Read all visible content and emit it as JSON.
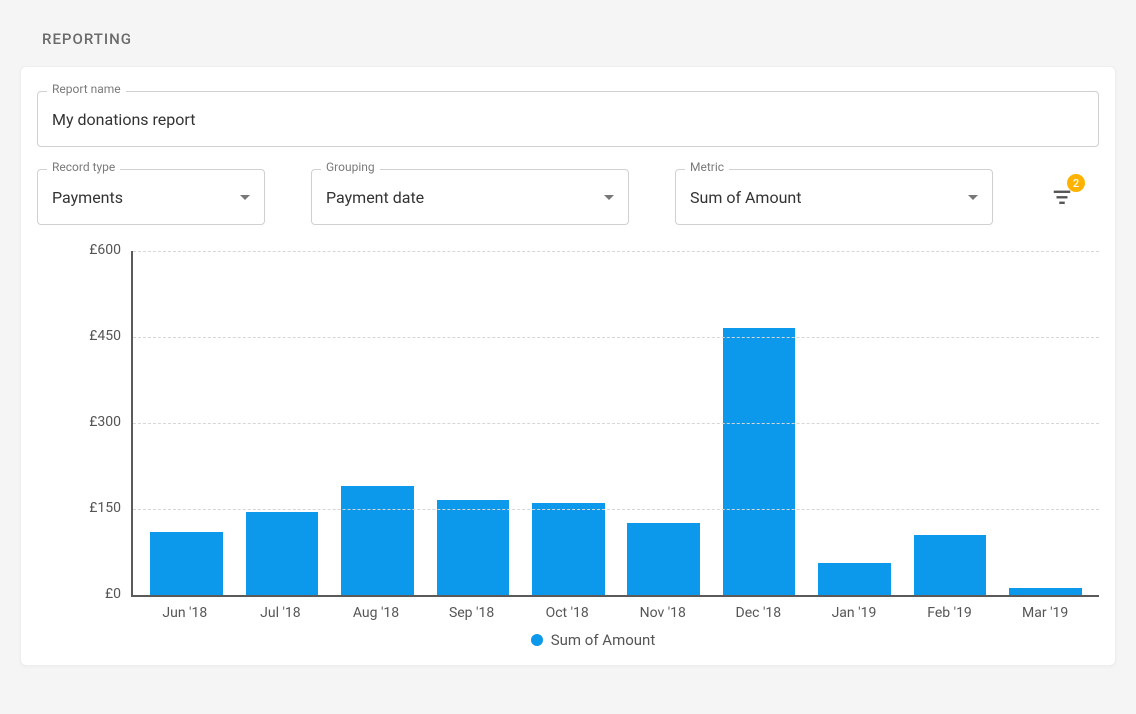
{
  "page_title": "REPORTING",
  "report_name": {
    "label": "Report name",
    "value": "My donations report"
  },
  "selects": {
    "record_type": {
      "label": "Record type",
      "value": "Payments"
    },
    "grouping": {
      "label": "Grouping",
      "value": "Payment date"
    },
    "metric": {
      "label": "Metric",
      "value": "Sum of Amount"
    }
  },
  "filter_count": "2",
  "legend_label": "Sum of Amount",
  "y_ticks": [
    "£600",
    "£450",
    "£300",
    "£150",
    "£0"
  ],
  "chart_data": {
    "type": "bar",
    "categories": [
      "Jun '18",
      "Jul '18",
      "Aug '18",
      "Sep '18",
      "Oct '18",
      "Nov '18",
      "Dec '18",
      "Jan '19",
      "Feb '19",
      "Mar '19"
    ],
    "values": [
      110,
      145,
      190,
      165,
      160,
      125,
      465,
      55,
      105,
      12
    ],
    "ylabel": "",
    "xlabel": "",
    "ylim": [
      0,
      600
    ],
    "currency_prefix": "£",
    "series": [
      {
        "name": "Sum of Amount",
        "color": "#0c98eb"
      }
    ]
  }
}
